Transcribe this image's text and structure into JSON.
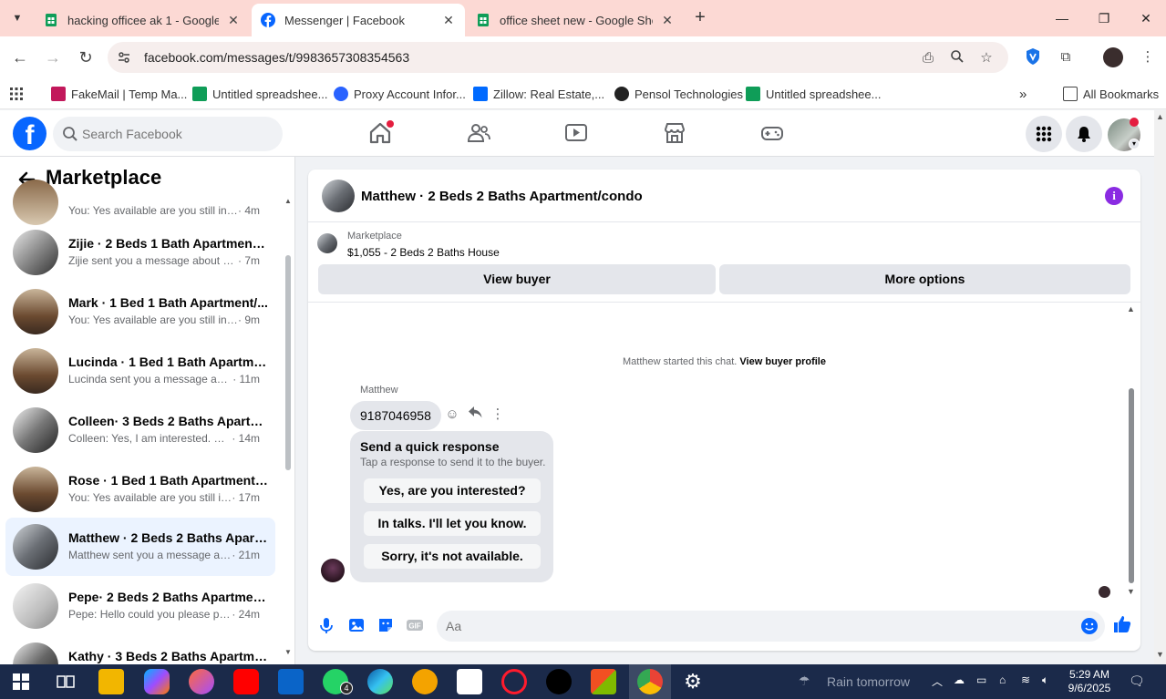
{
  "browser": {
    "tabs": [
      {
        "title": "hacking officee ak 1 - Google S",
        "icon": "google-sheets-icon",
        "active": false
      },
      {
        "title": "Messenger | Facebook",
        "icon": "facebook-icon",
        "active": true
      },
      {
        "title": "office sheet new - Google Shee",
        "icon": "google-sheets-icon",
        "active": false
      }
    ],
    "url": "facebook.com/messages/t/9983657308354563",
    "bookmarks": [
      {
        "label": "FakeMail | Temp Ma...",
        "icon": "fakemail-icon"
      },
      {
        "label": "Untitled spreadshee...",
        "icon": "google-sheets-icon"
      },
      {
        "label": "Proxy Account Infor...",
        "icon": "proxy-icon"
      },
      {
        "label": "Zillow: Real Estate,...",
        "icon": "zillow-icon"
      },
      {
        "label": "Pensol Technologies",
        "icon": "pensol-icon"
      },
      {
        "label": "Untitled spreadshee...",
        "icon": "google-sheets-icon"
      }
    ],
    "all_bookmarks": "All Bookmarks"
  },
  "fb": {
    "search_placeholder": "Search Facebook"
  },
  "left": {
    "title": "Marketplace",
    "partial_top": {
      "snippet": "You: Yes available are you still inter...",
      "time": " · 4m"
    },
    "conversations": [
      {
        "name": "Zijie · 2 Beds 1 Bath Apartment/...",
        "snippet": "Zijie sent you a message about yo...",
        "time": " · 7m",
        "active": false
      },
      {
        "name": "Mark · 1 Bed 1 Bath Apartment/...",
        "snippet": "You: Yes available are you still inter...",
        "time": " · 9m",
        "active": false
      },
      {
        "name": "Lucinda · 1 Bed 1 Bath Apartmen...",
        "snippet": "Lucinda sent you a message abo...",
        "time": " · 11m",
        "active": false
      },
      {
        "name": "Colleen· 3 Beds 2 Baths Apartm...",
        "snippet": "Colleen: Yes, I am interested. My ...",
        "time": " · 14m",
        "active": false
      },
      {
        "name": "Rose · 1 Bed 1 Bath Apartment/c...",
        "snippet": "You: Yes available are you still int...",
        "time": " · 17m",
        "active": false
      },
      {
        "name": "Matthew · 2 Beds 2 Baths Apart...",
        "snippet": "Matthew sent you a message ab...",
        "time": " · 21m",
        "active": true
      },
      {
        "name": "Pepe· 2 Beds 2 Baths Apartment...",
        "snippet": "Pepe: Hello could you please pro...",
        "time": " · 24m",
        "active": false
      },
      {
        "name": "Kathy · 3 Beds 2 Baths Apartme...",
        "snippet": "",
        "time": "",
        "active": false
      }
    ]
  },
  "chat": {
    "title": "Matthew · 2 Beds 2 Baths Apartment/condo",
    "listing_source": "Marketplace",
    "listing_item": "$1,055 - 2 Beds 2 Baths House",
    "view_buyer": "View buyer",
    "more_options": "More options",
    "system_text": "Matthew started this chat.",
    "system_link": "View buyer profile",
    "sender": "Matthew",
    "message": "9187046958",
    "quick_title": "Send a quick response",
    "quick_sub": "Tap a response to send it to the buyer.",
    "quick_responses": [
      "Yes, are you interested?",
      "In talks. I'll let you know.",
      "Sorry, it's not available."
    ],
    "input_placeholder": "Aa"
  },
  "taskbar": {
    "weather": "Rain tomorrow",
    "time": "5:29 AM",
    "date": "9/6/2025",
    "whatsapp_badge": "4"
  }
}
